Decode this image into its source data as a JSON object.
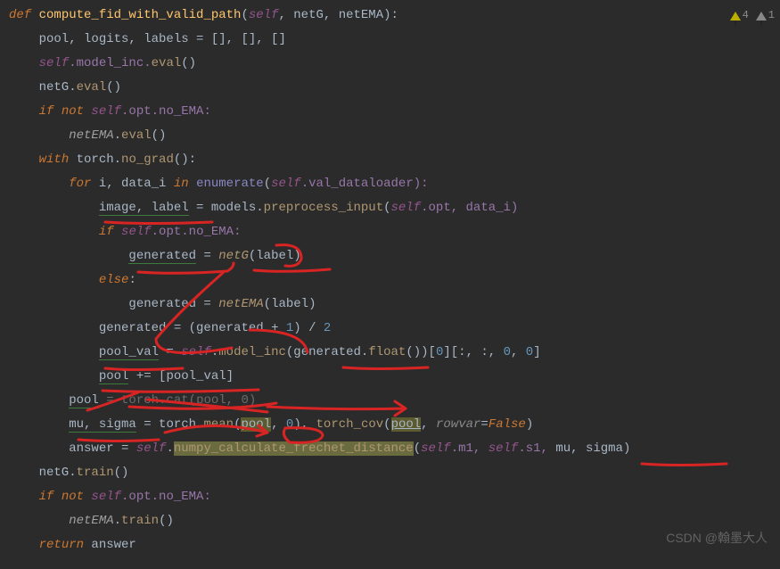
{
  "warnings": {
    "yellow": "4",
    "grey": "1"
  },
  "watermark": "CSDN @翰墨大人",
  "code": {
    "l1": {
      "def": "def ",
      "name": "compute_fid_with_valid_path",
      "p1": "(",
      "self": "self",
      "c1": ", ",
      "a1": "netG",
      "c2": ", ",
      "a2": "netEMA",
      "p2": "):"
    },
    "l2": "    pool, logits, labels = [], [], []",
    "l3": {
      "a": "    ",
      "self": "self",
      "b": ".model_inc.",
      "m": "eval",
      "c": "()"
    },
    "l4": {
      "a": "    netG.",
      "m": "eval",
      "c": "()"
    },
    "l5": {
      "a": "    ",
      "k": "if not ",
      "self": "self",
      "b": ".opt.no_EMA:"
    },
    "l6": {
      "a": "        ",
      "v": "netEMA",
      "b": ".",
      "m": "eval",
      "c": "()"
    },
    "l7": {
      "a": "    ",
      "k": "with ",
      "b": "torch.",
      "m": "no_grad",
      "c": "():"
    },
    "l8": {
      "a": "        ",
      "k1": "for ",
      "b": "i, data_i ",
      "k2": "in ",
      "fn": "enumerate",
      "p1": "(",
      "self": "self",
      "c": ".val_dataloader):"
    },
    "l9": {
      "a": "            ",
      "vars": "image, label",
      "eq": " = models.",
      "m": "preprocess_input",
      "p1": "(",
      "self": "self",
      "b": ".opt, data_i)"
    },
    "l10": {
      "a": "            ",
      "k": "if ",
      "self": "self",
      "b": ".opt.no_EMA:"
    },
    "l11": {
      "a": "                ",
      "v": "generated",
      "eq": " = ",
      "fn": "netG",
      "p": "(label)"
    },
    "l12": {
      "a": "            ",
      "k": "else",
      "b": ":"
    },
    "l13": {
      "a": "                generated = ",
      "fn": "netEMA",
      "b": "(label)"
    },
    "l14": {
      "a": "            generated = (generated ",
      "op1": "+ ",
      "n1": "1",
      "b": ") ",
      "op2": "/ ",
      "n2": "2"
    },
    "l15": {
      "a": "            ",
      "v": "pool_val",
      "eq": " = ",
      "self": "self",
      "b": ".",
      "m": "model_inc",
      "p1": "(generated.",
      "m2": "float",
      "p2": "())[",
      "n0": "0",
      "s1": "][:, :, ",
      "n1": "0",
      "c": ", ",
      "n2": "0",
      "e": "]"
    },
    "l16": {
      "a": "            ",
      "v": "pool",
      "op": " += ",
      "b": "[pool_val]"
    },
    "l17": {
      "a": "        ",
      "v": "pool",
      "eq": " = torch.",
      "m": "cat",
      "p1": "(pool, ",
      "n": "0",
      "p2": ")"
    },
    "l18": {
      "a": "        ",
      "vars": "mu, sigma",
      "eq": " = torch.",
      "m": "mean",
      "p1": "(",
      "arg1": "pool",
      "c1": ", ",
      "n": "0",
      "p2": "), ",
      "fn2": "torch_cov",
      "p3": "(",
      "arg2": "pool",
      "c2": ", ",
      "kw": "rowvar",
      "eq2": "=",
      "val": "False",
      "p4": ")"
    },
    "l19": {
      "a": "        answer = ",
      "self": "self",
      "b": ".",
      "m": "numpy_calculate_frechet_distance",
      "p1": "(",
      "self2": "self",
      "a1": ".m1, ",
      "self3": "self",
      "a2": ".s1, ",
      "args": "mu, sigma",
      "p2": ")"
    },
    "l20": {
      "a": "    netG.",
      "m": "train",
      "b": "()"
    },
    "l21": {
      "a": "    ",
      "k": "if not ",
      "self": "self",
      "b": ".opt.no_EMA:"
    },
    "l22": {
      "a": "        ",
      "v": "netEMA",
      "b": ".",
      "m": "train",
      "c": "()"
    },
    "l23": {
      "a": "    ",
      "k": "return ",
      "b": "answer"
    }
  }
}
